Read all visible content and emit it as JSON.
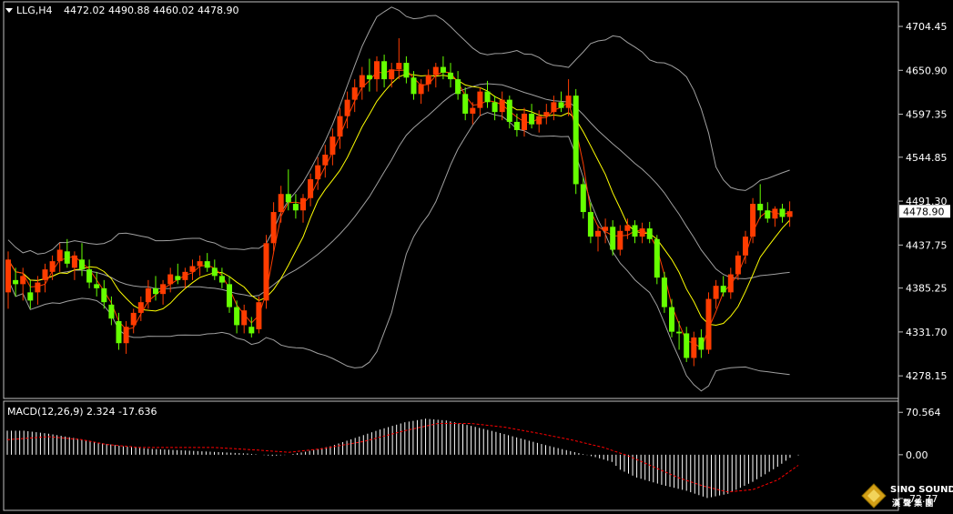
{
  "header": {
    "symbol": "LLG,H4",
    "ohlc": "4472.02 4490.88 4460.02 4478.90",
    "macd_label": "MACD(12,26,9) 2.324 -17.636"
  },
  "logo": {
    "brand": "SINO SOUND",
    "sub": "漢 聲 集 團"
  },
  "colors": {
    "background": "#000000",
    "frame": "#c0c0c0",
    "bull": "#ff3c00",
    "bear": "#66ff00",
    "ma_fast": "#ff3c00",
    "ma_slow": "#ffff00",
    "bands": "#a0a0a0",
    "macd_hist": "#ffffff",
    "macd_signal": "#ff0000"
  },
  "chart_data": [
    {
      "type": "candlestick",
      "title": "LLG,H4",
      "ylim": [
        4255,
        4730
      ],
      "yticks": [
        "4704.45",
        "4650.90",
        "4597.35",
        "4544.85",
        "4491.30",
        "4437.75",
        "4385.25",
        "4331.70",
        "4278.15"
      ],
      "current_price": "4478.90",
      "candles": [
        {
          "o": 4380,
          "h": 4430,
          "l": 4360,
          "c": 4420
        },
        {
          "o": 4395,
          "h": 4410,
          "l": 4375,
          "c": 4390
        },
        {
          "o": 4390,
          "h": 4410,
          "l": 4370,
          "c": 4400
        },
        {
          "o": 4380,
          "h": 4395,
          "l": 4360,
          "c": 4370
        },
        {
          "o": 4380,
          "h": 4400,
          "l": 4365,
          "c": 4392
        },
        {
          "o": 4395,
          "h": 4415,
          "l": 4380,
          "c": 4408
        },
        {
          "o": 4405,
          "h": 4425,
          "l": 4395,
          "c": 4418
        },
        {
          "o": 4418,
          "h": 4440,
          "l": 4405,
          "c": 4432
        },
        {
          "o": 4430,
          "h": 4445,
          "l": 4410,
          "c": 4415
        },
        {
          "o": 4410,
          "h": 4430,
          "l": 4395,
          "c": 4425
        },
        {
          "o": 4420,
          "h": 4440,
          "l": 4400,
          "c": 4408
        },
        {
          "o": 4408,
          "h": 4420,
          "l": 4385,
          "c": 4392
        },
        {
          "o": 4390,
          "h": 4405,
          "l": 4375,
          "c": 4385
        },
        {
          "o": 4385,
          "h": 4395,
          "l": 4360,
          "c": 4368
        },
        {
          "o": 4365,
          "h": 4375,
          "l": 4340,
          "c": 4348
        },
        {
          "o": 4345,
          "h": 4355,
          "l": 4310,
          "c": 4318
        },
        {
          "o": 4318,
          "h": 4345,
          "l": 4305,
          "c": 4338
        },
        {
          "o": 4340,
          "h": 4360,
          "l": 4330,
          "c": 4355
        },
        {
          "o": 4355,
          "h": 4375,
          "l": 4345,
          "c": 4368
        },
        {
          "o": 4368,
          "h": 4395,
          "l": 4360,
          "c": 4385
        },
        {
          "o": 4385,
          "h": 4400,
          "l": 4370,
          "c": 4378
        },
        {
          "o": 4378,
          "h": 4395,
          "l": 4365,
          "c": 4390
        },
        {
          "o": 4390,
          "h": 4410,
          "l": 4380,
          "c": 4402
        },
        {
          "o": 4400,
          "h": 4415,
          "l": 4390,
          "c": 4395
        },
        {
          "o": 4395,
          "h": 4410,
          "l": 4385,
          "c": 4405
        },
        {
          "o": 4405,
          "h": 4420,
          "l": 4395,
          "c": 4412
        },
        {
          "o": 4412,
          "h": 4425,
          "l": 4400,
          "c": 4418
        },
        {
          "o": 4418,
          "h": 4428,
          "l": 4405,
          "c": 4410
        },
        {
          "o": 4410,
          "h": 4420,
          "l": 4395,
          "c": 4400
        },
        {
          "o": 4400,
          "h": 4410,
          "l": 4385,
          "c": 4392
        },
        {
          "o": 4390,
          "h": 4400,
          "l": 4355,
          "c": 4362
        },
        {
          "o": 4362,
          "h": 4370,
          "l": 4330,
          "c": 4340
        },
        {
          "o": 4340,
          "h": 4365,
          "l": 4330,
          "c": 4358
        },
        {
          "o": 4338,
          "h": 4350,
          "l": 4325,
          "c": 4330
        },
        {
          "o": 4335,
          "h": 4375,
          "l": 4330,
          "c": 4368
        },
        {
          "o": 4370,
          "h": 4450,
          "l": 4360,
          "c": 4440
        },
        {
          "o": 4440,
          "h": 4490,
          "l": 4430,
          "c": 4478
        },
        {
          "o": 4478,
          "h": 4510,
          "l": 4465,
          "c": 4500
        },
        {
          "o": 4500,
          "h": 4530,
          "l": 4480,
          "c": 4490
        },
        {
          "o": 4488,
          "h": 4500,
          "l": 4470,
          "c": 4480
        },
        {
          "o": 4480,
          "h": 4500,
          "l": 4465,
          "c": 4495
        },
        {
          "o": 4495,
          "h": 4525,
          "l": 4485,
          "c": 4518
        },
        {
          "o": 4518,
          "h": 4545,
          "l": 4505,
          "c": 4535
        },
        {
          "o": 4535,
          "h": 4560,
          "l": 4520,
          "c": 4548
        },
        {
          "o": 4548,
          "h": 4580,
          "l": 4535,
          "c": 4570
        },
        {
          "o": 4570,
          "h": 4605,
          "l": 4555,
          "c": 4595
        },
        {
          "o": 4595,
          "h": 4625,
          "l": 4580,
          "c": 4615
        },
        {
          "o": 4615,
          "h": 4640,
          "l": 4600,
          "c": 4630
        },
        {
          "o": 4630,
          "h": 4655,
          "l": 4615,
          "c": 4645
        },
        {
          "o": 4645,
          "h": 4665,
          "l": 4625,
          "c": 4640
        },
        {
          "o": 4640,
          "h": 4668,
          "l": 4625,
          "c": 4662
        },
        {
          "o": 4662,
          "h": 4670,
          "l": 4630,
          "c": 4640
        },
        {
          "o": 4640,
          "h": 4660,
          "l": 4630,
          "c": 4652
        },
        {
          "o": 4652,
          "h": 4690,
          "l": 4640,
          "c": 4660
        },
        {
          "o": 4660,
          "h": 4668,
          "l": 4635,
          "c": 4642
        },
        {
          "o": 4642,
          "h": 4650,
          "l": 4615,
          "c": 4622
        },
        {
          "o": 4622,
          "h": 4640,
          "l": 4610,
          "c": 4634
        },
        {
          "o": 4634,
          "h": 4652,
          "l": 4625,
          "c": 4645
        },
        {
          "o": 4645,
          "h": 4660,
          "l": 4630,
          "c": 4655
        },
        {
          "o": 4655,
          "h": 4668,
          "l": 4640,
          "c": 4648
        },
        {
          "o": 4648,
          "h": 4660,
          "l": 4630,
          "c": 4640
        },
        {
          "o": 4640,
          "h": 4650,
          "l": 4615,
          "c": 4622
        },
        {
          "o": 4622,
          "h": 4630,
          "l": 4590,
          "c": 4598
        },
        {
          "o": 4598,
          "h": 4612,
          "l": 4585,
          "c": 4605
        },
        {
          "o": 4605,
          "h": 4630,
          "l": 4595,
          "c": 4625
        },
        {
          "o": 4625,
          "h": 4638,
          "l": 4605,
          "c": 4612
        },
        {
          "o": 4612,
          "h": 4620,
          "l": 4590,
          "c": 4600
        },
        {
          "o": 4600,
          "h": 4625,
          "l": 4590,
          "c": 4615
        },
        {
          "o": 4615,
          "h": 4620,
          "l": 4580,
          "c": 4588
        },
        {
          "o": 4588,
          "h": 4598,
          "l": 4570,
          "c": 4578
        },
        {
          "o": 4578,
          "h": 4605,
          "l": 4570,
          "c": 4598
        },
        {
          "o": 4598,
          "h": 4610,
          "l": 4580,
          "c": 4585
        },
        {
          "o": 4585,
          "h": 4602,
          "l": 4575,
          "c": 4595
        },
        {
          "o": 4595,
          "h": 4610,
          "l": 4585,
          "c": 4600
        },
        {
          "o": 4600,
          "h": 4620,
          "l": 4590,
          "c": 4612
        },
        {
          "o": 4612,
          "h": 4625,
          "l": 4600,
          "c": 4605
        },
        {
          "o": 4605,
          "h": 4640,
          "l": 4595,
          "c": 4620
        },
        {
          "o": 4620,
          "h": 4628,
          "l": 4500,
          "c": 4512
        },
        {
          "o": 4512,
          "h": 4520,
          "l": 4470,
          "c": 4478
        },
        {
          "o": 4478,
          "h": 4490,
          "l": 4440,
          "c": 4448
        },
        {
          "o": 4448,
          "h": 4462,
          "l": 4430,
          "c": 4455
        },
        {
          "o": 4455,
          "h": 4470,
          "l": 4440,
          "c": 4460
        },
        {
          "o": 4460,
          "h": 4468,
          "l": 4425,
          "c": 4432
        },
        {
          "o": 4432,
          "h": 4462,
          "l": 4425,
          "c": 4455
        },
        {
          "o": 4455,
          "h": 4470,
          "l": 4445,
          "c": 4462
        },
        {
          "o": 4462,
          "h": 4468,
          "l": 4440,
          "c": 4448
        },
        {
          "o": 4448,
          "h": 4465,
          "l": 4440,
          "c": 4458
        },
        {
          "o": 4458,
          "h": 4466,
          "l": 4440,
          "c": 4445
        },
        {
          "o": 4445,
          "h": 4450,
          "l": 4390,
          "c": 4398
        },
        {
          "o": 4398,
          "h": 4405,
          "l": 4355,
          "c": 4362
        },
        {
          "o": 4362,
          "h": 4372,
          "l": 4325,
          "c": 4332
        },
        {
          "o": 4332,
          "h": 4345,
          "l": 4310,
          "c": 4330
        },
        {
          "o": 4330,
          "h": 4338,
          "l": 4295,
          "c": 4300
        },
        {
          "o": 4300,
          "h": 4332,
          "l": 4290,
          "c": 4325
        },
        {
          "o": 4325,
          "h": 4335,
          "l": 4300,
          "c": 4310
        },
        {
          "o": 4310,
          "h": 4380,
          "l": 4305,
          "c": 4372
        },
        {
          "o": 4372,
          "h": 4395,
          "l": 4360,
          "c": 4388
        },
        {
          "o": 4388,
          "h": 4400,
          "l": 4375,
          "c": 4380
        },
        {
          "o": 4380,
          "h": 4410,
          "l": 4372,
          "c": 4402
        },
        {
          "o": 4402,
          "h": 4430,
          "l": 4395,
          "c": 4425
        },
        {
          "o": 4425,
          "h": 4455,
          "l": 4415,
          "c": 4448
        },
        {
          "o": 4448,
          "h": 4495,
          "l": 4440,
          "c": 4488
        },
        {
          "o": 4488,
          "h": 4512,
          "l": 4470,
          "c": 4480
        },
        {
          "o": 4480,
          "h": 4490,
          "l": 4465,
          "c": 4470
        },
        {
          "o": 4470,
          "h": 4485,
          "l": 4460,
          "c": 4482
        },
        {
          "o": 4482,
          "h": 4488,
          "l": 4465,
          "c": 4472
        },
        {
          "o": 4472,
          "h": 4491,
          "l": 4460,
          "c": 4479
        }
      ]
    },
    {
      "type": "histogram",
      "title": "MACD(12,26,9) 2.324 -17.636",
      "ylim": [
        -85,
        80
      ],
      "yticks": [
        "70.564",
        "0.00",
        "-72.77"
      ],
      "macd_points": [
        [
          0,
          40
        ],
        [
          4,
          40
        ],
        [
          10,
          35
        ],
        [
          16,
          28
        ],
        [
          22,
          20
        ],
        [
          28,
          14
        ],
        [
          34,
          10
        ],
        [
          40,
          8
        ],
        [
          46,
          6
        ],
        [
          52,
          4
        ],
        [
          58,
          2
        ],
        [
          64,
          -2
        ],
        [
          68,
          0
        ],
        [
          72,
          5
        ],
        [
          78,
          14
        ],
        [
          84,
          28
        ],
        [
          90,
          42
        ],
        [
          96,
          54
        ],
        [
          101,
          60
        ],
        [
          106,
          57
        ],
        [
          112,
          48
        ],
        [
          118,
          38
        ],
        [
          124,
          27
        ],
        [
          130,
          16
        ],
        [
          136,
          6
        ],
        [
          142,
          -4
        ],
        [
          146,
          -12
        ],
        [
          148,
          -25
        ],
        [
          152,
          -38
        ],
        [
          158,
          -50
        ],
        [
          164,
          -60
        ],
        [
          169,
          -72
        ],
        [
          174,
          -65
        ],
        [
          180,
          -45
        ],
        [
          186,
          -20
        ],
        [
          190,
          0
        ],
        [
          191,
          -1
        ]
      ],
      "signal_points": [
        [
          0,
          25
        ],
        [
          10,
          30
        ],
        [
          18,
          25
        ],
        [
          24,
          17
        ],
        [
          32,
          12
        ],
        [
          40,
          12
        ],
        [
          50,
          12
        ],
        [
          60,
          8
        ],
        [
          68,
          4
        ],
        [
          76,
          10
        ],
        [
          86,
          22
        ],
        [
          96,
          40
        ],
        [
          104,
          52
        ],
        [
          112,
          52
        ],
        [
          120,
          46
        ],
        [
          128,
          36
        ],
        [
          136,
          25
        ],
        [
          144,
          12
        ],
        [
          150,
          -2
        ],
        [
          156,
          -20
        ],
        [
          162,
          -38
        ],
        [
          168,
          -52
        ],
        [
          174,
          -62
        ],
        [
          180,
          -58
        ],
        [
          186,
          -42
        ],
        [
          191,
          -17.636
        ]
      ]
    }
  ]
}
